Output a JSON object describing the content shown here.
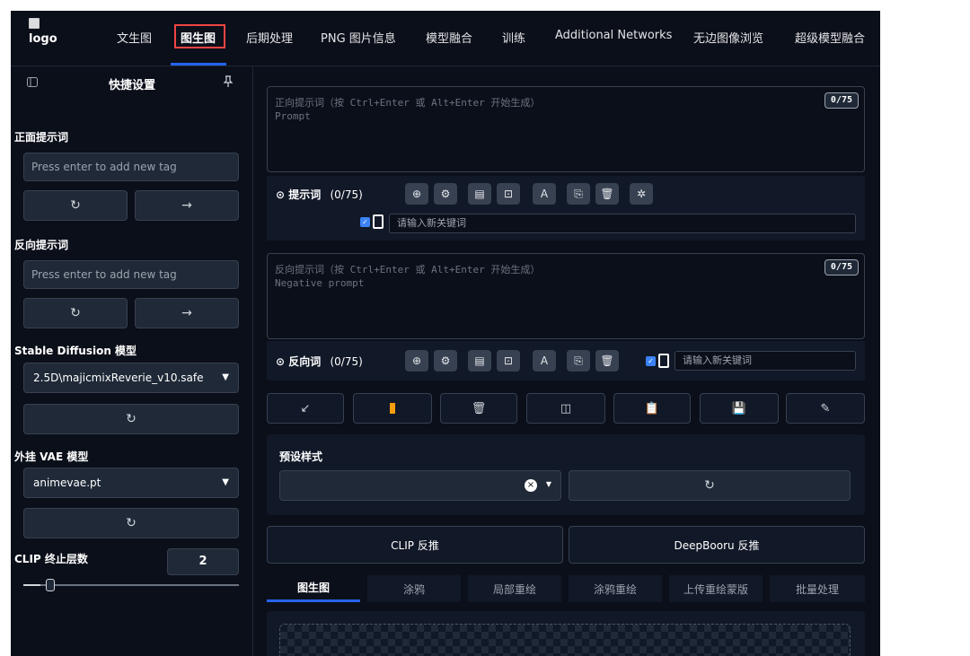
{
  "logo": {
    "alt": "logo"
  },
  "nav": {
    "tabs": [
      {
        "label": "文生图"
      },
      {
        "label": "图生图"
      },
      {
        "label": "后期处理"
      },
      {
        "label": "PNG 图片信息"
      },
      {
        "label": "模型融合"
      },
      {
        "label": "训练"
      },
      {
        "label": "Additional Networks"
      },
      {
        "label": "无边图像浏览"
      },
      {
        "label": "超级模型融合"
      }
    ],
    "active_index": 1
  },
  "sidebar": {
    "title": "快捷设置",
    "pin_icon": "pin-icon",
    "positive_label": "正面提示词",
    "positive_placeholder": "Press enter to add new tag",
    "negative_label": "反向提示词",
    "negative_placeholder": "Press enter to add new tag",
    "sd_model_label": "Stable Diffusion 模型",
    "sd_model_value": "2.5D\\majicmixReverie_v10.safe",
    "vae_label": "外挂 VAE 模型",
    "vae_value": "animevae.pt",
    "clip_label": "CLIP 终止层数",
    "clip_value": "2",
    "clip_slider_fraction": 0.08
  },
  "main": {
    "positive_prompt": {
      "placeholder_line1": "正向提示词（按 Ctrl+Enter 或 Alt+Enter 开始生成）",
      "placeholder_line2": "Prompt",
      "counter": "0/75"
    },
    "positive_toolbar": {
      "title": "提示词",
      "count": "(0/75)",
      "keyword_placeholder": "请输入新关键词"
    },
    "negative_prompt": {
      "placeholder_line1": "反向提示词（按 Ctrl+Enter 或 Alt+Enter 开始生成）",
      "placeholder_line2": "Negative prompt",
      "counter": "0/75"
    },
    "negative_toolbar": {
      "title": "反向词",
      "count": "(0/75)",
      "keyword_placeholder": "请输入新关键词"
    },
    "styles": {
      "label": "预设样式"
    },
    "interrogate": {
      "clip": "CLIP 反推",
      "deepbooru": "DeepBooru 反推"
    },
    "subtabs": [
      {
        "label": "图生图"
      },
      {
        "label": "涂鸦"
      },
      {
        "label": "局部重绘"
      },
      {
        "label": "涂鸦重绘"
      },
      {
        "label": "上传重绘蒙版"
      },
      {
        "label": "批量处理"
      }
    ]
  },
  "colors": {
    "background": "#0b0f19",
    "accent": "#2563eb",
    "highlight_border": "#ef4444"
  }
}
